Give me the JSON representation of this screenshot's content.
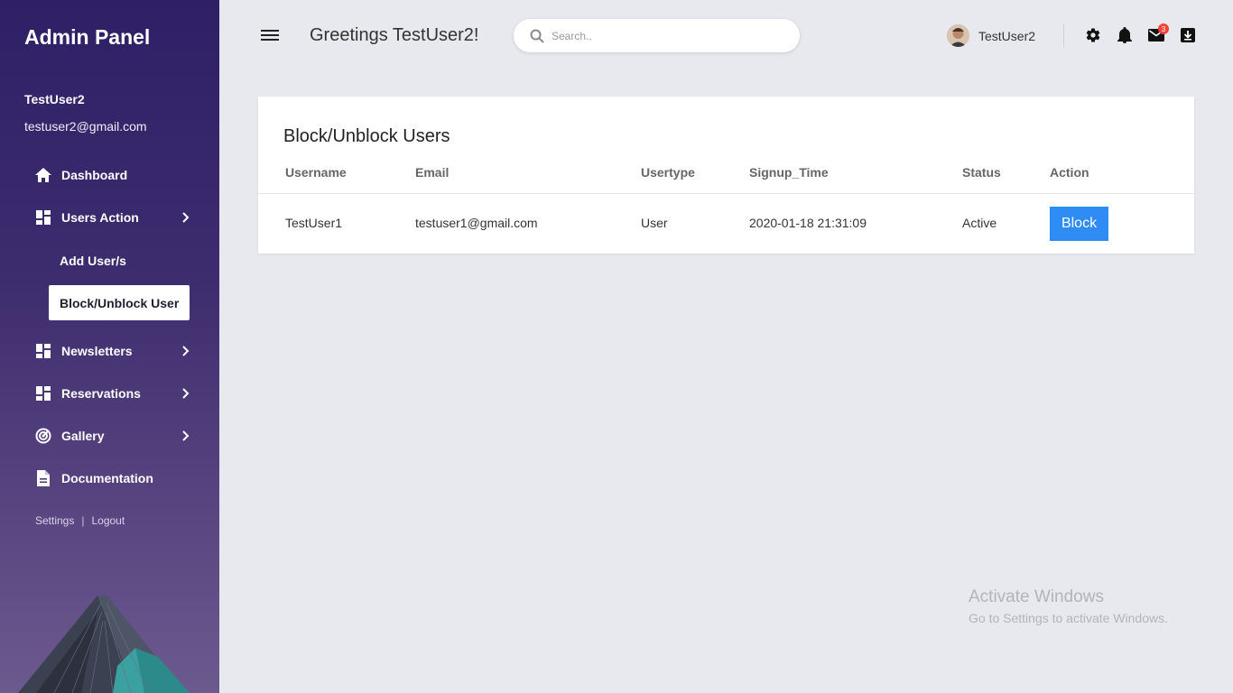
{
  "sidebar": {
    "brand": "Admin Panel",
    "user": {
      "name": "TestUser2",
      "email": "testuser2@gmail.com"
    },
    "nav": [
      {
        "label": "Dashboard",
        "icon": "home-icon"
      },
      {
        "label": "Users Action",
        "icon": "grid-icon",
        "expandable": true
      },
      {
        "label": "Newsletters",
        "icon": "grid-icon",
        "expandable": true
      },
      {
        "label": "Reservations",
        "icon": "grid-icon",
        "expandable": true
      },
      {
        "label": "Gallery",
        "icon": "radar-icon",
        "expandable": true
      },
      {
        "label": "Documentation",
        "icon": "document-icon"
      }
    ],
    "sub_items": [
      {
        "label": "Add User/s",
        "active": false
      },
      {
        "label": "Block/Unblock User",
        "active": true
      }
    ],
    "footer": {
      "settings": "Settings",
      "separator": "|",
      "logout": "Logout"
    }
  },
  "header": {
    "greeting": "Greetings TestUser2!",
    "search_placeholder": "Search..",
    "profile_name": "TestUser2",
    "mail_badge": "3"
  },
  "main": {
    "title": "Block/Unblock Users",
    "columns": [
      "Username",
      "Email",
      "Usertype",
      "Signup_Time",
      "Status",
      "Action"
    ],
    "rows": [
      {
        "username": "TestUser1",
        "email": "testuser1@gmail.com",
        "usertype": "User",
        "signup_time": "2020-01-18 21:31:09",
        "status": "Active",
        "action": "Block"
      }
    ]
  },
  "watermark": {
    "title": "Activate Windows",
    "subtitle": "Go to Settings to activate Windows."
  },
  "colors": {
    "sidebar_top": "#2f1f66",
    "sidebar_bottom": "#6b5a8e",
    "accent_button": "#2f8cf5",
    "badge": "#f44336",
    "background": "#e8e8ef"
  }
}
